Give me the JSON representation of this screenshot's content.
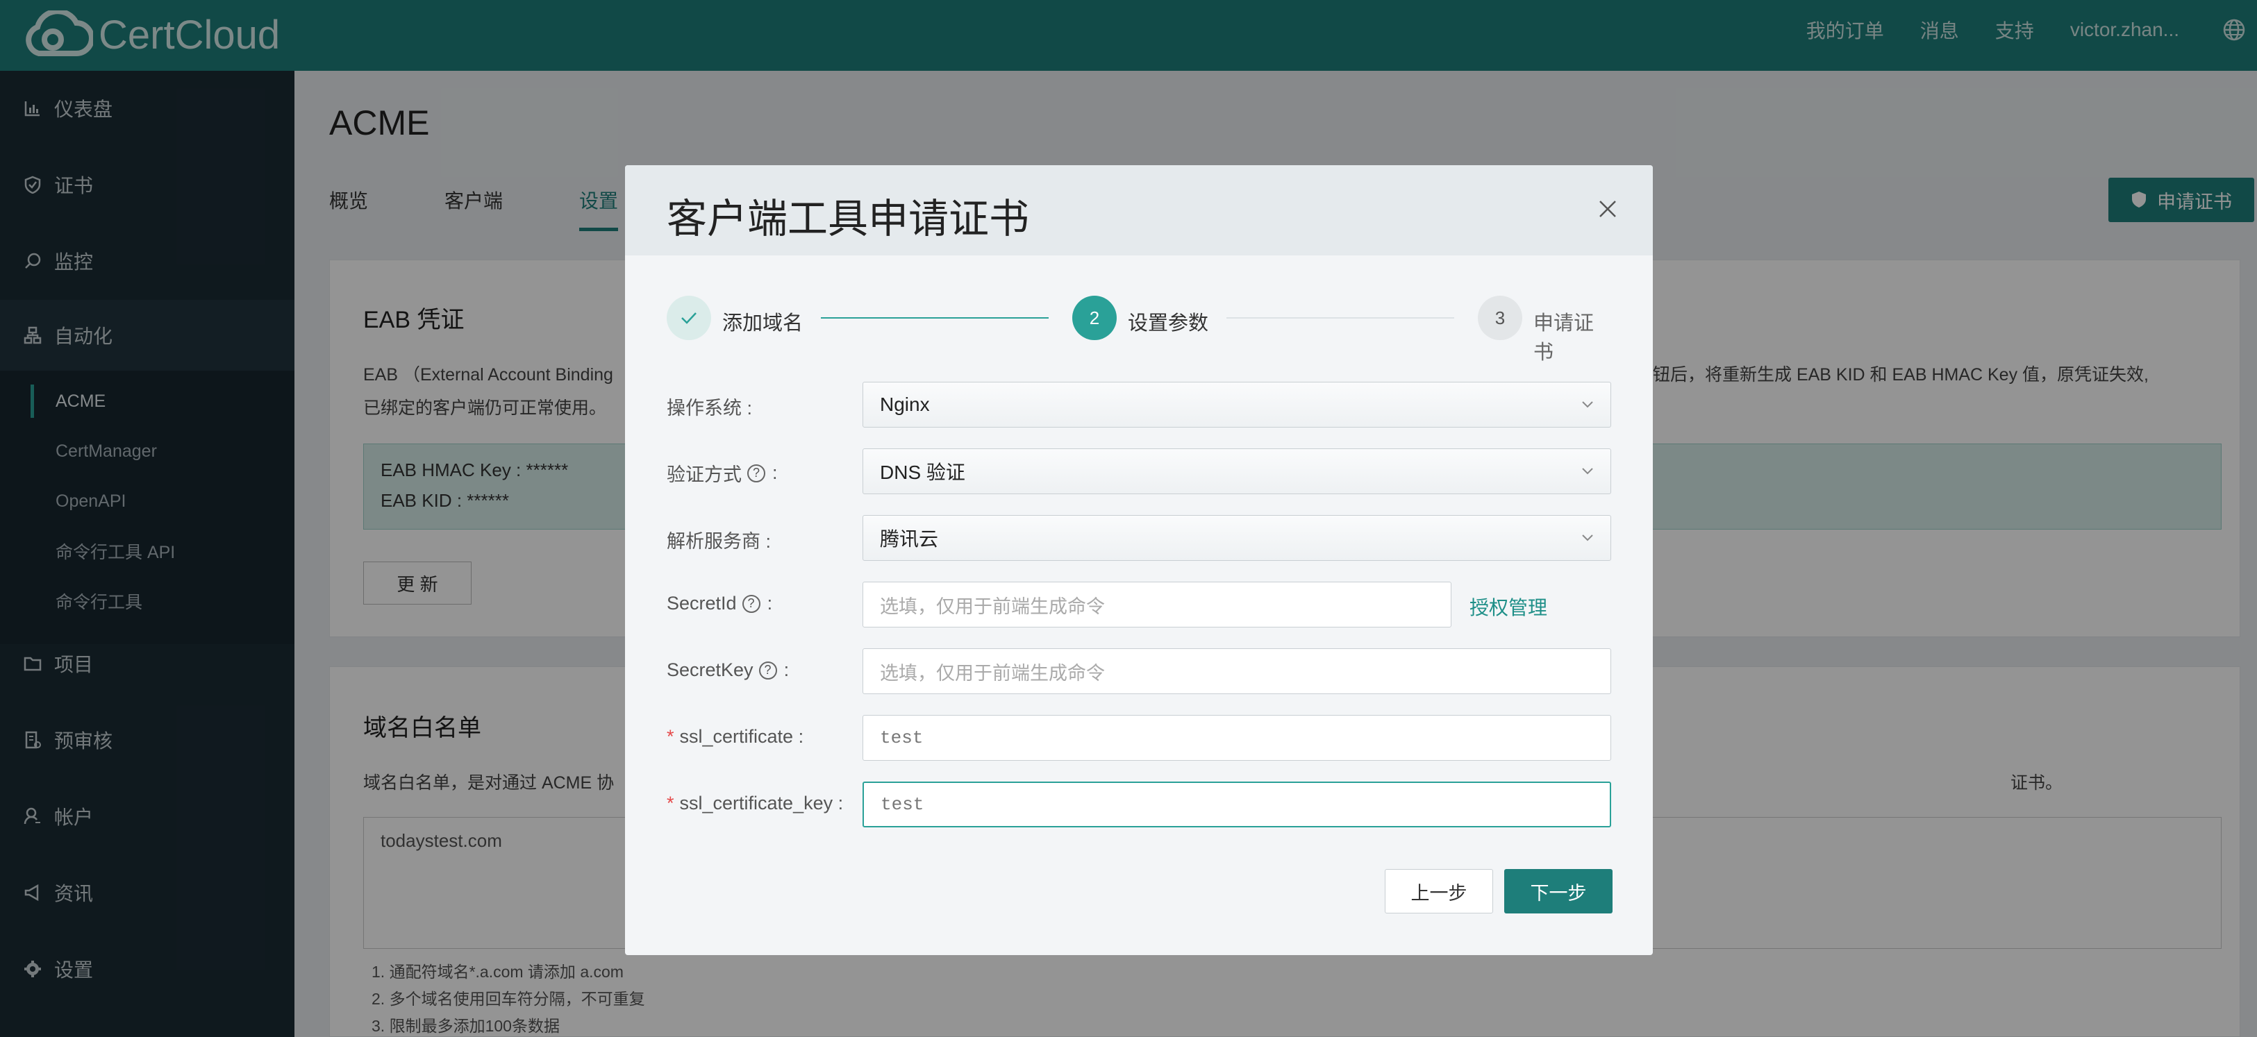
{
  "app": {
    "logo_text": "CertCloud"
  },
  "topnav": {
    "orders": "我的订单",
    "messages": "消息",
    "support": "支持",
    "user": "victor.zhan..."
  },
  "sidebar": {
    "items": [
      {
        "label": "仪表盘",
        "icon": "chart-icon"
      },
      {
        "label": "证书",
        "icon": "shield-icon"
      },
      {
        "label": "监控",
        "icon": "search-icon"
      },
      {
        "label": "自动化",
        "icon": "org-icon"
      },
      {
        "label": "项目",
        "icon": "folder-icon"
      },
      {
        "label": "预审核",
        "icon": "doc-check-icon"
      },
      {
        "label": "帐户",
        "icon": "user-icon"
      },
      {
        "label": "资讯",
        "icon": "megaphone-icon"
      },
      {
        "label": "设置",
        "icon": "gear-icon"
      }
    ],
    "sub_items": [
      "ACME",
      "CertManager",
      "OpenAPI",
      "命令行工具 API",
      "命令行工具"
    ]
  },
  "page": {
    "title": "ACME",
    "tabs": [
      "概览",
      "客户端",
      "设置"
    ],
    "apply_button": "申请证书",
    "eab": {
      "title": "EAB 凭证",
      "desc_1": "EAB （External Account Binding",
      "desc_1_right": "按钮后，将重新生成 EAB KID 和 EAB HMAC Key 值，原凭证失效,",
      "desc_2": "已绑定的客户端仍可正常使用。",
      "hmac": "EAB HMAC Key : ******",
      "kid": "EAB KID : ******",
      "update_button": "更 新"
    },
    "whitelist": {
      "title": "域名白名单",
      "desc": "域名白名单，是对通过 ACME 协",
      "desc_right": "证书。",
      "value": "todaystest.com",
      "notes": [
        "1. 通配符域名*.a.com 请添加 a.com",
        "2. 多个域名使用回车符分隔，不可重复",
        "3. 限制最多添加100条数据"
      ]
    }
  },
  "modal": {
    "title": "客户端工具申请证书",
    "steps": [
      {
        "label": "添加域名",
        "state": "done"
      },
      {
        "num": "2",
        "label": "设置参数",
        "state": "active"
      },
      {
        "num": "3",
        "label": "申请证书",
        "state": "pending"
      }
    ],
    "fields": {
      "os": {
        "label": "操作系统 :",
        "value": "Nginx"
      },
      "verify": {
        "label": "验证方式",
        "value": "DNS 验证"
      },
      "dns": {
        "label": "解析服务商 :",
        "value": "腾讯云"
      },
      "secret_id": {
        "label": "SecretId",
        "placeholder": "选填，仅用于前端生成命令",
        "link": "授权管理"
      },
      "secret_key": {
        "label": "SecretKey",
        "placeholder": "选填，仅用于前端生成命令"
      },
      "ssl_cert": {
        "label": "ssl_certificate :",
        "value": "test"
      },
      "ssl_key": {
        "label": "ssl_certificate_key :",
        "value": "test"
      }
    },
    "colon": ":",
    "prev_button": "上一步",
    "next_button": "下一步"
  },
  "colors": {
    "brand": "#1e7e7a",
    "sidebar": "#1b2b35",
    "accent": "#2aa198"
  }
}
